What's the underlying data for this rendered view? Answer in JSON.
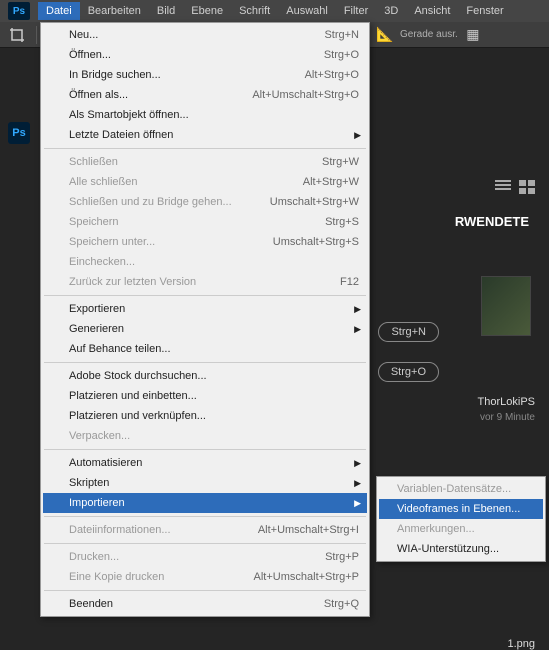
{
  "app": {
    "logo": "Ps"
  },
  "menubar": [
    "Datei",
    "Bearbeiten",
    "Bild",
    "Ebene",
    "Schrift",
    "Auswahl",
    "Filter",
    "3D",
    "Ansicht",
    "Fenster"
  ],
  "toolbar": {
    "gerade": "Gerade ausr."
  },
  "dropdown": {
    "groups": [
      [
        {
          "label": "Neu...",
          "shortcut": "Strg+N",
          "sub": false,
          "enabled": true
        },
        {
          "label": "Öffnen...",
          "shortcut": "Strg+O",
          "sub": false,
          "enabled": true
        },
        {
          "label": "In Bridge suchen...",
          "shortcut": "Alt+Strg+O",
          "sub": false,
          "enabled": true
        },
        {
          "label": "Öffnen als...",
          "shortcut": "Alt+Umschalt+Strg+O",
          "sub": false,
          "enabled": true
        },
        {
          "label": "Als Smartobjekt öffnen...",
          "shortcut": "",
          "sub": false,
          "enabled": true
        },
        {
          "label": "Letzte Dateien öffnen",
          "shortcut": "",
          "sub": true,
          "enabled": true
        }
      ],
      [
        {
          "label": "Schließen",
          "shortcut": "Strg+W",
          "sub": false,
          "enabled": false
        },
        {
          "label": "Alle schließen",
          "shortcut": "Alt+Strg+W",
          "sub": false,
          "enabled": false
        },
        {
          "label": "Schließen und zu Bridge gehen...",
          "shortcut": "Umschalt+Strg+W",
          "sub": false,
          "enabled": false
        },
        {
          "label": "Speichern",
          "shortcut": "Strg+S",
          "sub": false,
          "enabled": false
        },
        {
          "label": "Speichern unter...",
          "shortcut": "Umschalt+Strg+S",
          "sub": false,
          "enabled": false
        },
        {
          "label": "Einchecken...",
          "shortcut": "",
          "sub": false,
          "enabled": false
        },
        {
          "label": "Zurück zur letzten Version",
          "shortcut": "F12",
          "sub": false,
          "enabled": false
        }
      ],
      [
        {
          "label": "Exportieren",
          "shortcut": "",
          "sub": true,
          "enabled": true
        },
        {
          "label": "Generieren",
          "shortcut": "",
          "sub": true,
          "enabled": true
        },
        {
          "label": "Auf Behance teilen...",
          "shortcut": "",
          "sub": false,
          "enabled": true
        }
      ],
      [
        {
          "label": "Adobe Stock durchsuchen...",
          "shortcut": "",
          "sub": false,
          "enabled": true
        },
        {
          "label": "Platzieren und einbetten...",
          "shortcut": "",
          "sub": false,
          "enabled": true
        },
        {
          "label": "Platzieren und verknüpfen...",
          "shortcut": "",
          "sub": false,
          "enabled": true
        },
        {
          "label": "Verpacken...",
          "shortcut": "",
          "sub": false,
          "enabled": false
        }
      ],
      [
        {
          "label": "Automatisieren",
          "shortcut": "",
          "sub": true,
          "enabled": true
        },
        {
          "label": "Skripten",
          "shortcut": "",
          "sub": true,
          "enabled": true
        },
        {
          "label": "Importieren",
          "shortcut": "",
          "sub": true,
          "enabled": true,
          "hl": true
        }
      ],
      [
        {
          "label": "Dateiinformationen...",
          "shortcut": "Alt+Umschalt+Strg+I",
          "sub": false,
          "enabled": false
        }
      ],
      [
        {
          "label": "Drucken...",
          "shortcut": "Strg+P",
          "sub": false,
          "enabled": false
        },
        {
          "label": "Eine Kopie drucken",
          "shortcut": "Alt+Umschalt+Strg+P",
          "sub": false,
          "enabled": false
        }
      ],
      [
        {
          "label": "Beenden",
          "shortcut": "Strg+Q",
          "sub": false,
          "enabled": true
        }
      ]
    ]
  },
  "submenu": [
    {
      "label": "Variablen-Datensätze...",
      "enabled": false,
      "hl": false
    },
    {
      "label": "Videoframes in Ebenen...",
      "enabled": true,
      "hl": true
    },
    {
      "label": "Anmerkungen...",
      "enabled": false,
      "hl": false
    },
    {
      "label": "WIA-Unterstützung...",
      "enabled": true,
      "hl": false
    }
  ],
  "bg": {
    "heading": "RWENDETE",
    "pill1": "Strg+N",
    "pill2": "Strg+O",
    "thumb1_label": "ThorLokiPS",
    "thumb1_sub": "vor 9 Minute",
    "thumb2_label": "1.png"
  }
}
